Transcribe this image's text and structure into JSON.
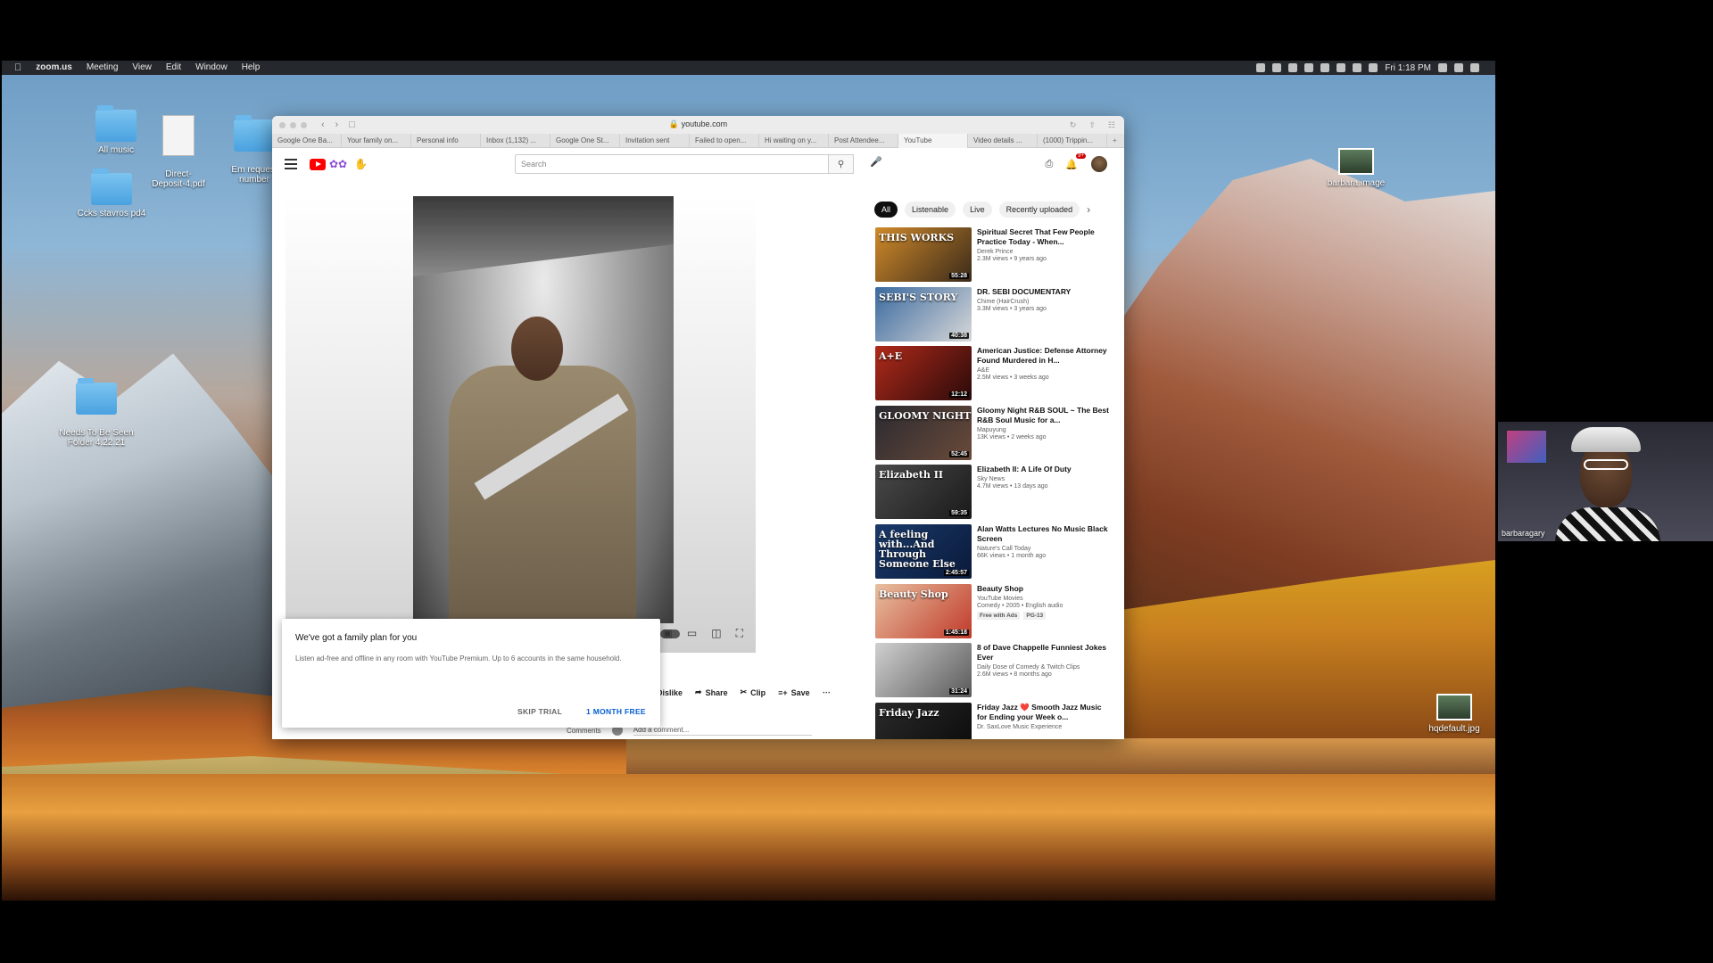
{
  "menubar": {
    "app": "zoom.us",
    "items": [
      "Meeting",
      "View",
      "Edit",
      "Window",
      "Help"
    ],
    "clock": "Fri 1:18 PM"
  },
  "desktop_icons": {
    "all_music": "All music",
    "direct_deposit": "Direct-\nDeposit-4.pdf",
    "em_request": "Em request\nnumber",
    "ccks": "Ccks stavros pd4",
    "needs_to_be_seen": "Needs To Be Seen\nFolder 4.22.21",
    "barbara_image": "barbara.image",
    "hqdefault": "hqdefault.jpg"
  },
  "browser": {
    "url": "youtube.com",
    "tabs": [
      "Google One Ba...",
      "Your family on...",
      "Personal info",
      "Inbox (1,132) ...",
      "Google One St...",
      "Invitation sent",
      "Failed to open...",
      "Hi waiting on y...",
      "Post Attendee...",
      "YouTube",
      "Video details ...",
      "(1000) Trippin..."
    ]
  },
  "youtube": {
    "search_placeholder": "Search",
    "notif_count": "9+",
    "chips": [
      "All",
      "Listenable",
      "Live",
      "Recently uploaded"
    ],
    "actions": {
      "dislike": "Dislike",
      "share": "Share",
      "clip": "Clip",
      "save": "Save"
    },
    "comments_label": "Comments",
    "add_comment_placeholder": "Add a comment...",
    "recommendations": [
      {
        "title": "Spiritual Secret That Few People Practice Today - When...",
        "channel": "Derek Prince",
        "meta": "2.3M views • 9 years ago",
        "duration": "55:28",
        "thumb_text": "THIS WORKS",
        "colors": [
          "#d08a2a",
          "#3a2a1a"
        ]
      },
      {
        "title": "DR. SEBI DOCUMENTARY",
        "channel": "Chime (HairCrush)",
        "meta": "3.3M views • 3 years ago",
        "duration": "40:38",
        "thumb_text": "SEBI'S STORY",
        "colors": [
          "#3a6aa0",
          "#d8d8d8"
        ]
      },
      {
        "title": "American Justice: Defense Attorney Found Murdered in H...",
        "channel": "A&E",
        "meta": "2.5M views • 3 weeks ago",
        "duration": "12:12",
        "thumb_text": "A+E",
        "colors": [
          "#b02a1a",
          "#2a0a0a"
        ]
      },
      {
        "title": "Gloomy Night R&B SOUL ~ The Best R&B Soul Music for a...",
        "channel": "Mapuyung",
        "meta": "13K views • 2 weeks ago",
        "duration": "52:45",
        "thumb_text": "GLOOMY NIGHT",
        "colors": [
          "#2a2a30",
          "#6a4a3a"
        ]
      },
      {
        "title": "Elizabeth II: A Life Of Duty",
        "channel": "Sky News",
        "meta": "4.7M views • 13 days ago",
        "duration": "59:35",
        "thumb_text": "Elizabeth II",
        "colors": [
          "#4a4a4a",
          "#1a1a1a"
        ]
      },
      {
        "title": "Alan Watts Lectures No Music Black Screen",
        "channel": "Nature's Call Today",
        "meta": "66K views • 1 month ago",
        "duration": "2:45:57",
        "thumb_text": "A feeling with...And Through Someone Else",
        "colors": [
          "#1a3a6a",
          "#0a1a3a"
        ]
      },
      {
        "title": "Beauty Shop",
        "channel": "YouTube Movies",
        "meta": "Comedy • 2005 • English audio",
        "duration": "1:45:18",
        "thumb_text": "Beauty Shop",
        "colors": [
          "#e8c0a0",
          "#c03a2a"
        ],
        "tags": [
          "Free with Ads",
          "PG-13"
        ]
      },
      {
        "title": "8 of Dave Chappelle Funniest Jokes Ever",
        "channel": "Daily Dose of Comedy & Twitch Clips",
        "meta": "2.6M views • 8 months ago",
        "duration": "31:24",
        "thumb_text": "",
        "colors": [
          "#d0d0d0",
          "#5a5a5a"
        ]
      },
      {
        "title": "Friday Jazz ❤️ Smooth Jazz Music for Ending your Week o...",
        "channel": "Dr. SaxLove Music Experience",
        "meta": "",
        "duration": "",
        "thumb_text": "Friday Jazz",
        "colors": [
          "#2a2a2a",
          "#0a0a0a"
        ]
      }
    ]
  },
  "popup": {
    "title": "We've got a family plan for you",
    "body": "Listen ad-free and offline in any room with YouTube Premium. Up to 6 accounts in the same household.",
    "skip_label": "SKIP TRIAL",
    "cta_label": "1 MONTH FREE"
  },
  "participant": {
    "name": "barbaragary"
  }
}
